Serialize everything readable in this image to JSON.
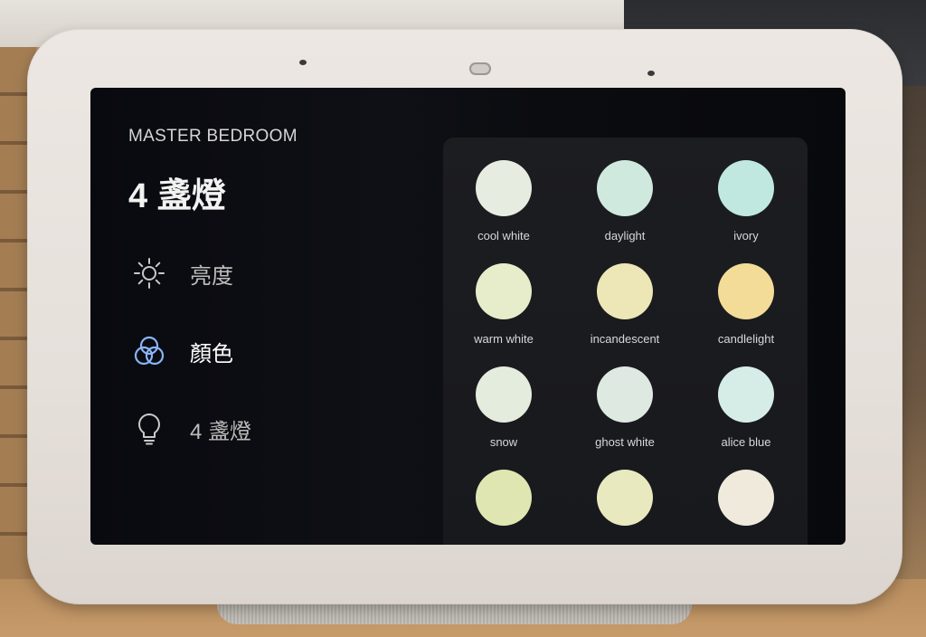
{
  "room_name": "MASTER BEDROOM",
  "title": "4 盞燈",
  "menu": [
    {
      "icon": "sun-icon",
      "label": "亮度",
      "selected": false
    },
    {
      "icon": "color-circles-icon",
      "label": "顏色",
      "selected": true
    },
    {
      "icon": "lightbulb-icon",
      "label": "4 盞燈",
      "selected": false
    }
  ],
  "theme": {
    "accent": "#8ab4f8",
    "icon_muted": "#c9c9c9"
  },
  "swatches": [
    {
      "label": "cool white",
      "color": "#e6ede0"
    },
    {
      "label": "daylight",
      "color": "#d0e9de"
    },
    {
      "label": "ivory",
      "color": "#c0e8e0"
    },
    {
      "label": "warm white",
      "color": "#e7ecca"
    },
    {
      "label": "incandescent",
      "color": "#ede6b6"
    },
    {
      "label": "candlelight",
      "color": "#f3dc98"
    },
    {
      "label": "snow",
      "color": "#e3ecdd"
    },
    {
      "label": "ghost white",
      "color": "#dde9e1"
    },
    {
      "label": "alice blue",
      "color": "#d5ede6"
    },
    {
      "color": "#dfe6b2"
    },
    {
      "color": "#e8e9bf"
    },
    {
      "color": "#efeadb"
    }
  ]
}
